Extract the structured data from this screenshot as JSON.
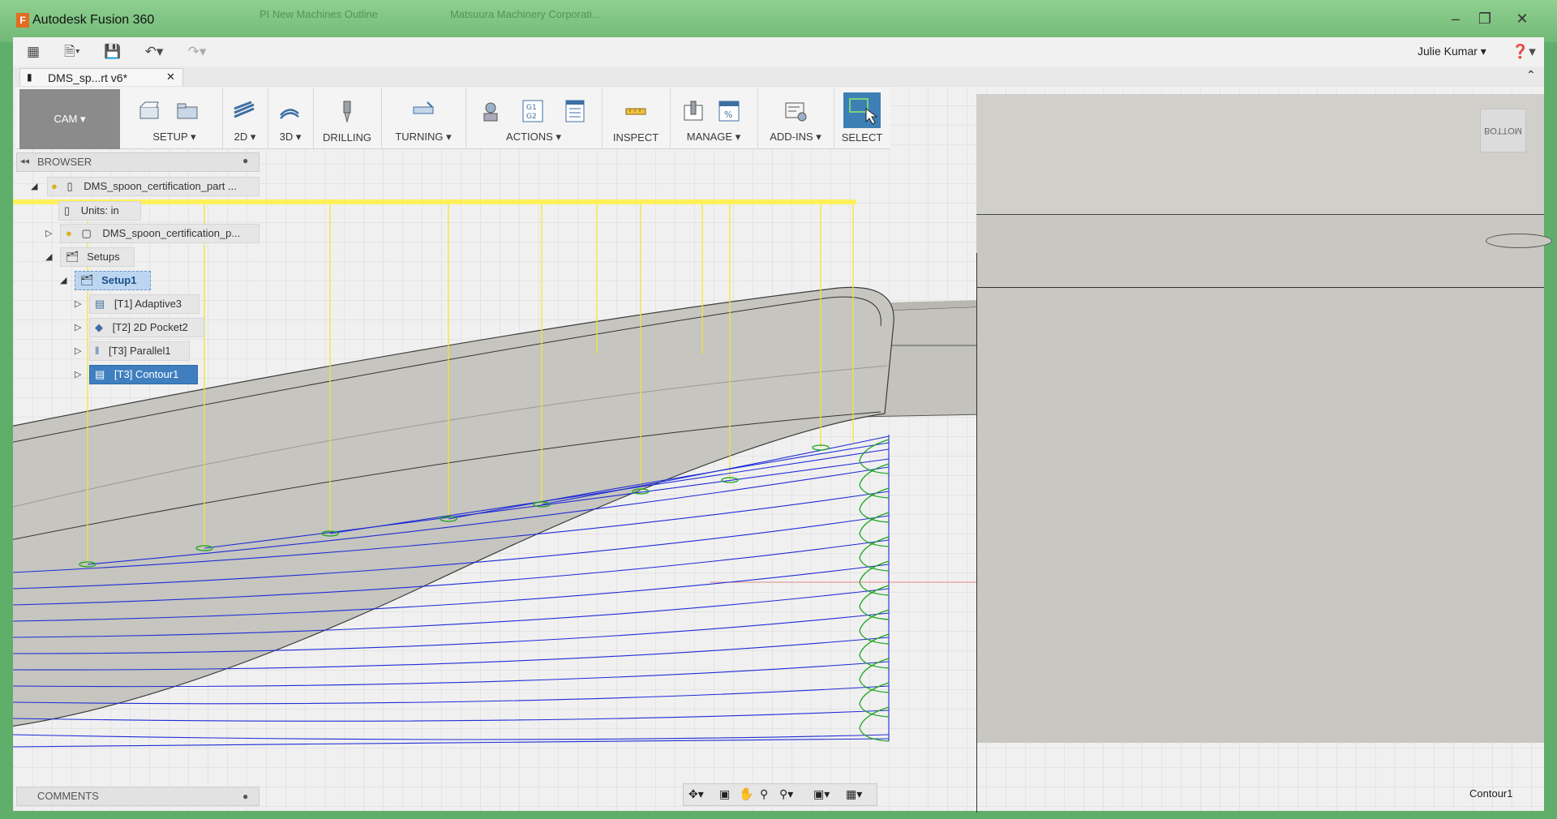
{
  "window": {
    "title": "Autodesk Fusion 360",
    "ghost_tab_1": "PI New Machines Outline",
    "ghost_tab_2": "Matsuura Machinery Corporati..."
  },
  "quick_access": {
    "user_name": "Julie Kumar"
  },
  "document_tab": {
    "label": "DMS_sp...rt v6*"
  },
  "toolbar": {
    "workspace": "CAM",
    "groups": {
      "setup": "SETUP",
      "twod": "2D",
      "threed": "3D",
      "drilling": "DRILLING",
      "turning": "TURNING",
      "actions": "ACTIONS",
      "inspect": "INSPECT",
      "manage": "MANAGE",
      "addins": "ADD-INS",
      "select": "SELECT"
    }
  },
  "browser": {
    "header": "BROWSER",
    "root": "DMS_spoon_certification_part ...",
    "units": "Units: in",
    "body": "DMS_spoon_certification_p...",
    "setups": "Setups",
    "setup1": "Setup1",
    "operations": [
      "[T1] Adaptive3",
      "[T2] 2D Pocket2",
      "[T3] Parallel1",
      "[T3] Contour1"
    ]
  },
  "comments": {
    "header": "COMMENTS"
  },
  "viewcube": {
    "face": "BOTTOM"
  },
  "status": {
    "selection": "Contour1"
  },
  "colors": {
    "accent": "#3d80b5",
    "toolpath_feed": "#1e2bd6",
    "toolpath_lead": "#1aa51a",
    "toolpath_rapid": "#ffff33",
    "model": "#c8c7c1"
  }
}
